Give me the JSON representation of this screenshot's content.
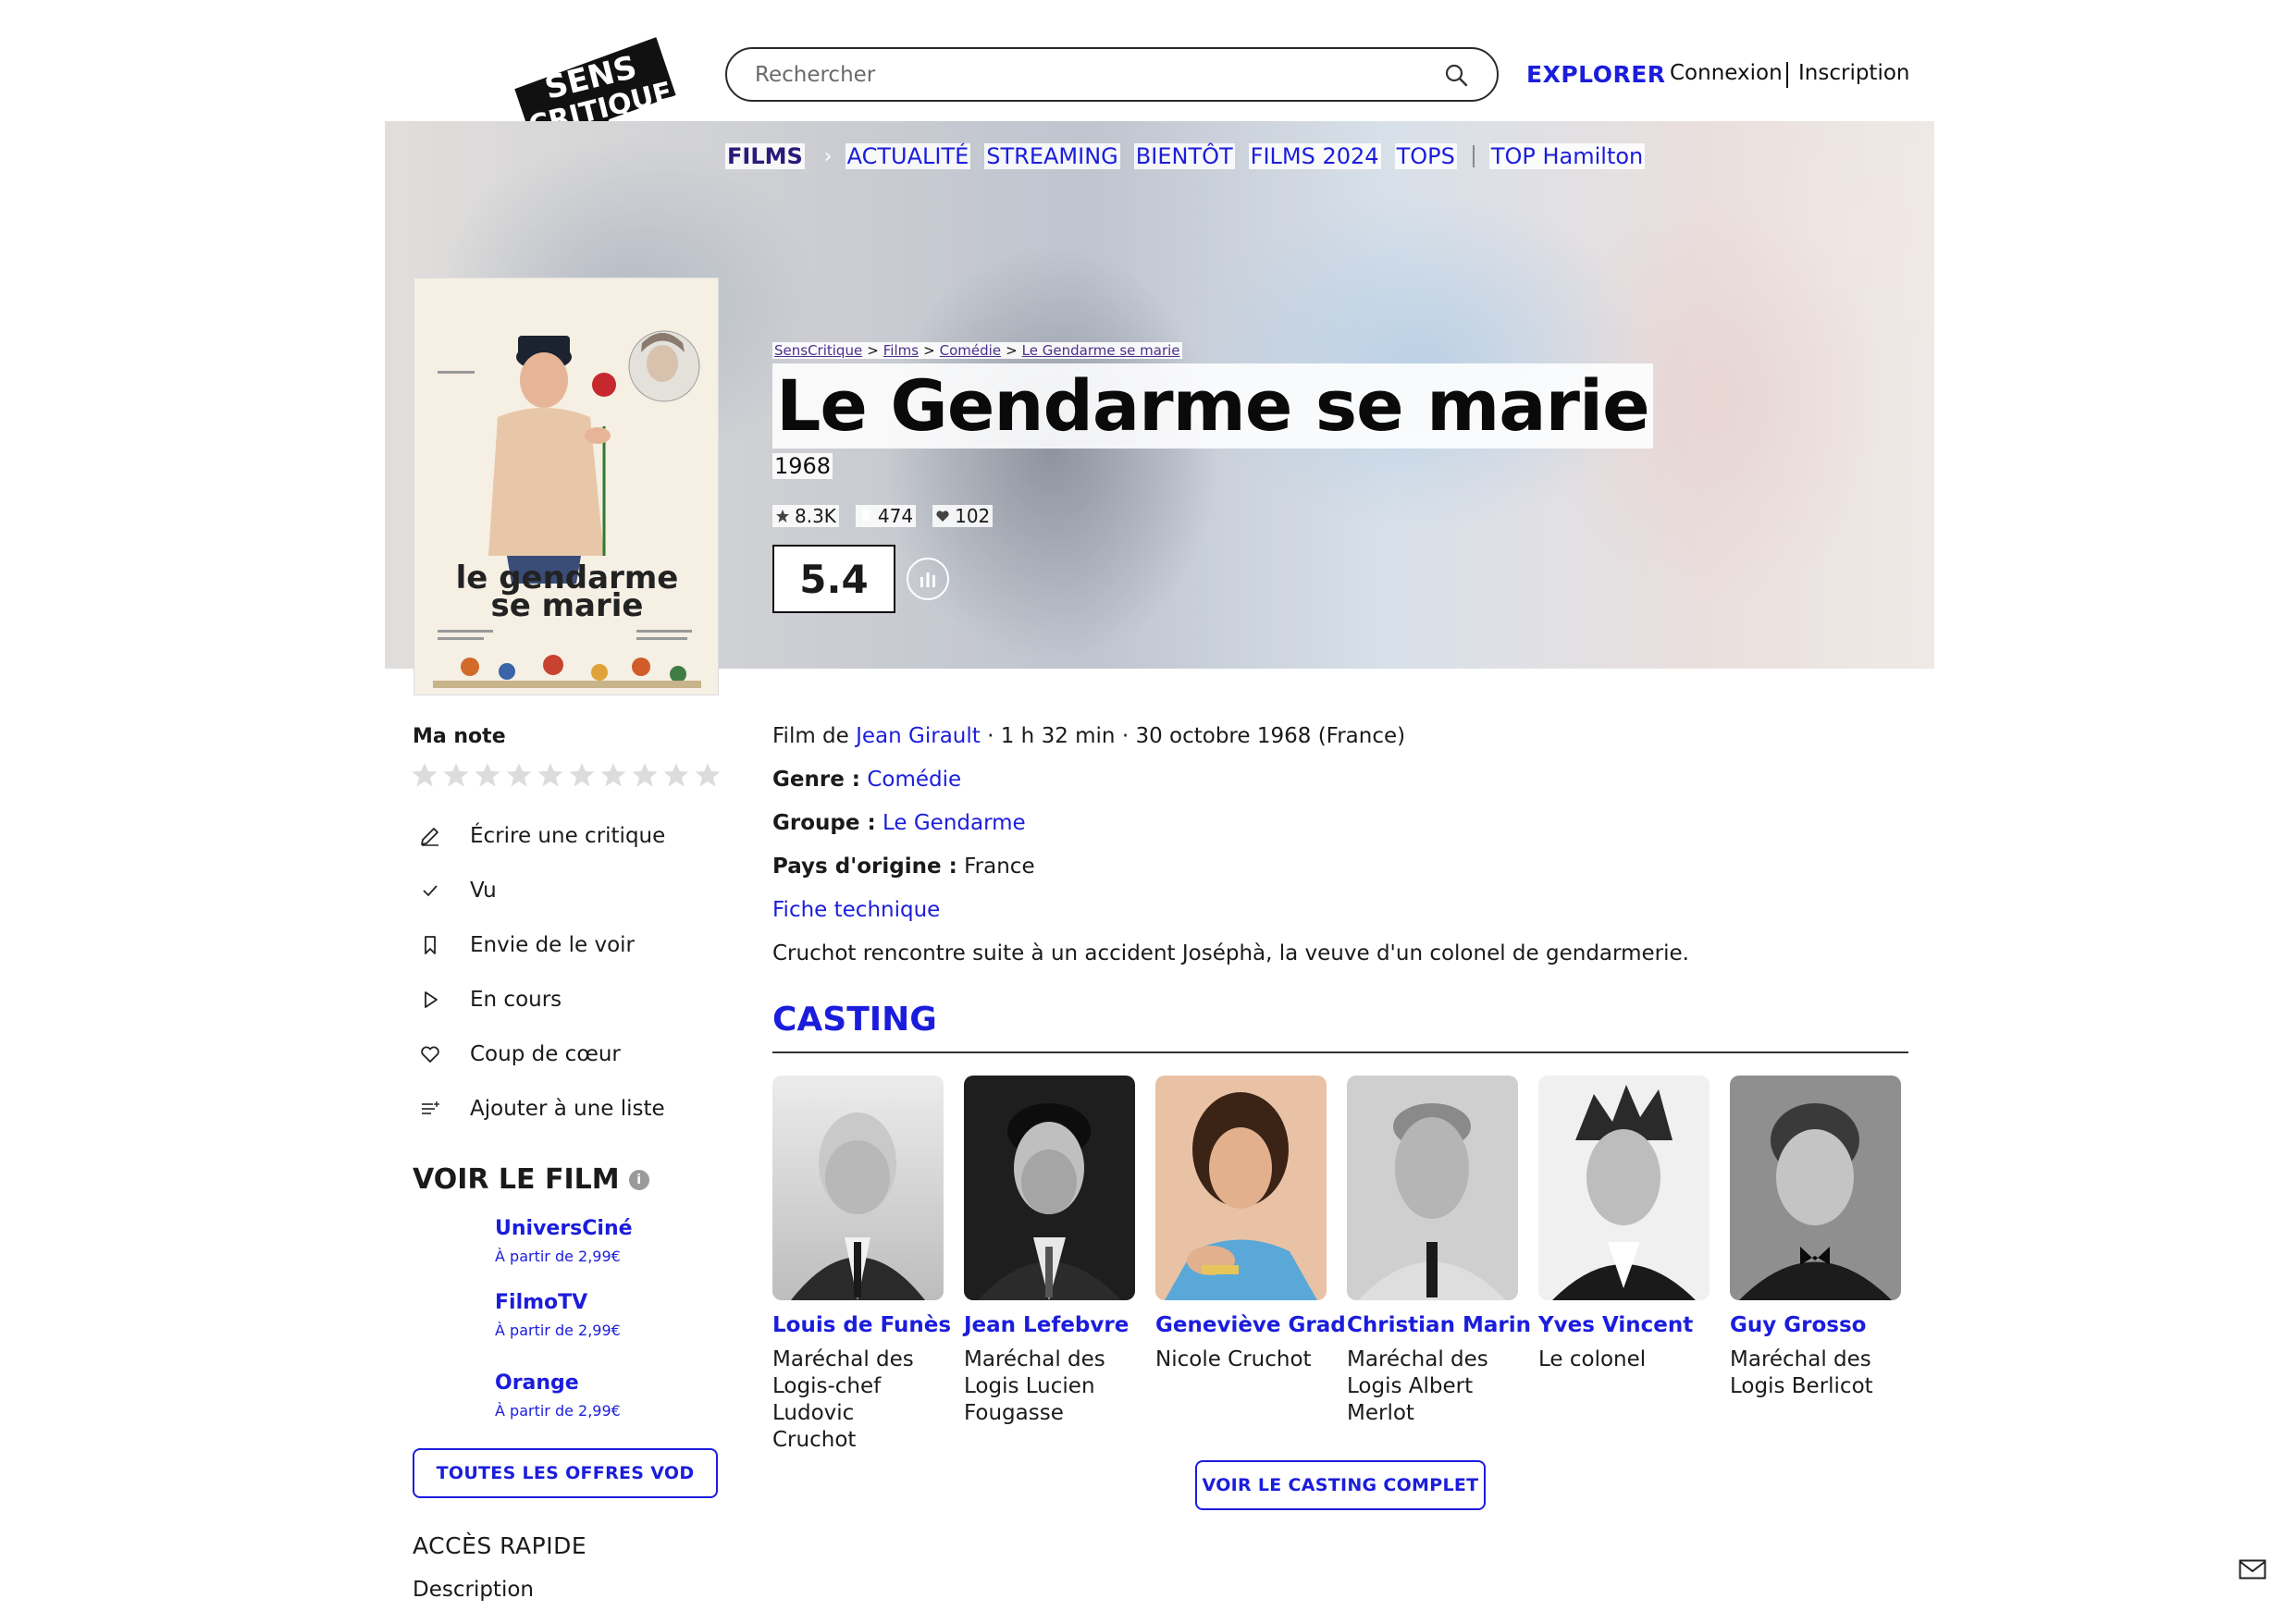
{
  "header": {
    "logo_text": [
      "SENS",
      "CRITIQUE"
    ],
    "search_placeholder": "Rechercher",
    "explorer": "EXPLORER",
    "connexion": "Connexion",
    "inscription": "Inscription"
  },
  "nav": {
    "films": "FILMS",
    "chevron": "›",
    "items": [
      "ACTUALITÉ",
      "STREAMING",
      "BIENTÔT",
      "FILMS 2024",
      "TOPS"
    ],
    "top_hamilton": "TOP Hamilton"
  },
  "breadcrumb": [
    "SensCritique",
    "Films",
    "Comédie",
    "Le Gendarme se marie"
  ],
  "breadcrumb_sep": ">",
  "movie": {
    "title": "Le Gendarme se marie",
    "year": "1968",
    "stats": {
      "ratings": "8.3K",
      "wishes": "474",
      "favorites": "102"
    },
    "score": "5.4",
    "poster_text": [
      "le gendarme",
      "se marie"
    ]
  },
  "sidebar": {
    "ma_note": "Ma note",
    "star_count": 10,
    "actions": [
      "Écrire une critique",
      "Vu",
      "Envie de le voir",
      "En cours",
      "Coup de cœur",
      "Ajouter à une liste"
    ],
    "voir_le_film": "VOIR LE FILM",
    "info_glyph": "i",
    "vod": [
      {
        "name": "UniversCiné",
        "price": "À partir de 2,99€"
      },
      {
        "name": "FilmoTV",
        "price": "À partir de 2,99€"
      },
      {
        "name": "Orange",
        "price": "À partir de 2,99€"
      }
    ],
    "vod_button": "TOUTES LES OFFRES VOD",
    "acces_rapide": "ACCÈS RAPIDE",
    "description_link": "Description"
  },
  "details": {
    "film_de": "Film de",
    "director": "Jean Girault",
    "meta": "· 1 h 32 min · 30 octobre 1968 (France)",
    "genre_label": "Genre :",
    "genre": "Comédie",
    "groupe_label": "Groupe :",
    "groupe": "Le Gendarme",
    "pays_label": "Pays d'origine :",
    "pays": "France",
    "fiche": "Fiche technique",
    "synopsis": "Cruchot rencontre suite à un accident Joséphà, la veuve d'un colonel de gendarmerie."
  },
  "casting": {
    "title": "CASTING",
    "actors": [
      {
        "name": "Louis de Funès",
        "role": "Maréchal des Logis-chef Ludovic Cruchot"
      },
      {
        "name": "Jean Lefebvre",
        "role": "Maréchal des Logis Lucien Fougasse"
      },
      {
        "name": "Geneviève Grad",
        "role": "Nicole Cruchot"
      },
      {
        "name": "Christian Marin",
        "role": "Maréchal des Logis Albert Merlot"
      },
      {
        "name": "Yves Vincent",
        "role": "Le colonel"
      },
      {
        "name": "Guy Grosso",
        "role": "Maréchal des Logis Berlicot"
      }
    ],
    "button": "VOIR LE CASTING COMPLET"
  },
  "colors": {
    "accent": "#1b1ddc",
    "films_nav": "#2a1a7a",
    "text": "#1a1a1a"
  }
}
